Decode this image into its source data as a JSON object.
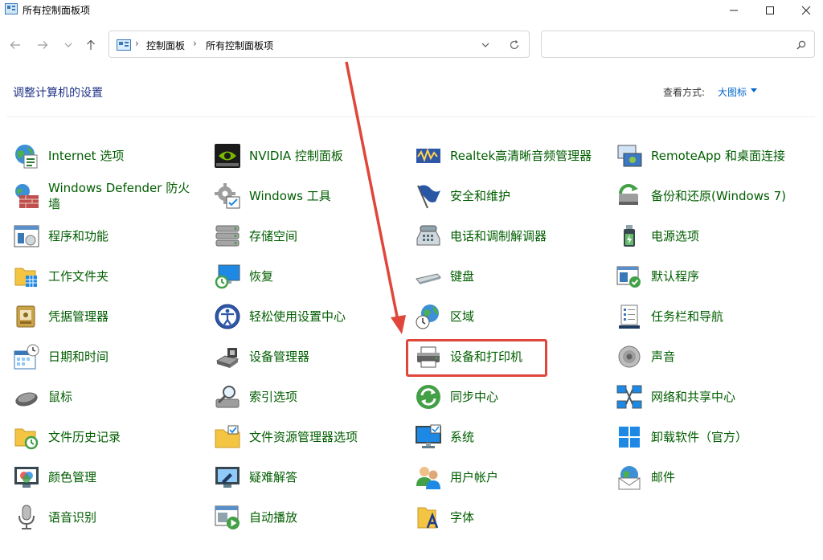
{
  "window": {
    "title": "所有控制面板项"
  },
  "address": {
    "crumbs": [
      "控制面板",
      "所有控制面板项"
    ],
    "search_placeholder": ""
  },
  "header": {
    "heading": "调整计算机的设置",
    "view_by_label": "查看方式:",
    "view_by_value": "大图标"
  },
  "items": [
    {
      "label": "Internet 选项",
      "icon": "globe-icon"
    },
    {
      "label": "NVIDIA 控制面板",
      "icon": "nvidia-icon"
    },
    {
      "label": "Realtek高清晰音频管理器",
      "icon": "realtek-audio-icon"
    },
    {
      "label": "RemoteApp 和桌面连接",
      "icon": "remoteapp-icon"
    },
    {
      "label": "Windows Defender 防火墙",
      "icon": "firewall-icon"
    },
    {
      "label": "Windows 工具",
      "icon": "tools-gear-icon"
    },
    {
      "label": "安全和维护",
      "icon": "flag-icon"
    },
    {
      "label": "备份和还原(Windows 7)",
      "icon": "backup-icon"
    },
    {
      "label": "程序和功能",
      "icon": "programs-icon"
    },
    {
      "label": "存储空间",
      "icon": "storage-icon"
    },
    {
      "label": "电话和调制解调器",
      "icon": "phone-modem-icon"
    },
    {
      "label": "电源选项",
      "icon": "power-icon"
    },
    {
      "label": "工作文件夹",
      "icon": "work-folder-icon"
    },
    {
      "label": "恢复",
      "icon": "recovery-icon"
    },
    {
      "label": "键盘",
      "icon": "keyboard-icon"
    },
    {
      "label": "默认程序",
      "icon": "default-programs-icon"
    },
    {
      "label": "凭据管理器",
      "icon": "credential-icon"
    },
    {
      "label": "轻松使用设置中心",
      "icon": "ease-of-access-icon"
    },
    {
      "label": "区域",
      "icon": "region-icon"
    },
    {
      "label": "任务栏和导航",
      "icon": "taskbar-icon"
    },
    {
      "label": "日期和时间",
      "icon": "datetime-icon"
    },
    {
      "label": "设备管理器",
      "icon": "device-manager-icon"
    },
    {
      "label": "设备和打印机",
      "icon": "printer-icon"
    },
    {
      "label": "声音",
      "icon": "speaker-icon"
    },
    {
      "label": "鼠标",
      "icon": "mouse-icon"
    },
    {
      "label": "索引选项",
      "icon": "indexing-icon"
    },
    {
      "label": "同步中心",
      "icon": "sync-icon"
    },
    {
      "label": "网络和共享中心",
      "icon": "network-icon"
    },
    {
      "label": "文件历史记录",
      "icon": "file-history-icon"
    },
    {
      "label": "文件资源管理器选项",
      "icon": "folder-options-icon"
    },
    {
      "label": "系统",
      "icon": "system-monitor-icon"
    },
    {
      "label": "卸载软件（官方）",
      "icon": "windows-logo-icon"
    },
    {
      "label": "颜色管理",
      "icon": "color-management-icon"
    },
    {
      "label": "疑难解答",
      "icon": "troubleshoot-icon"
    },
    {
      "label": "用户帐户",
      "icon": "user-accounts-icon"
    },
    {
      "label": "邮件",
      "icon": "mail-icon"
    },
    {
      "label": "语音识别",
      "icon": "microphone-icon"
    },
    {
      "label": "自动播放",
      "icon": "autoplay-icon"
    },
    {
      "label": "字体",
      "icon": "fonts-icon"
    }
  ],
  "colors": {
    "link_green": "#005d00",
    "heading_blue": "#1e3287",
    "highlight_red": "#e0463a"
  }
}
